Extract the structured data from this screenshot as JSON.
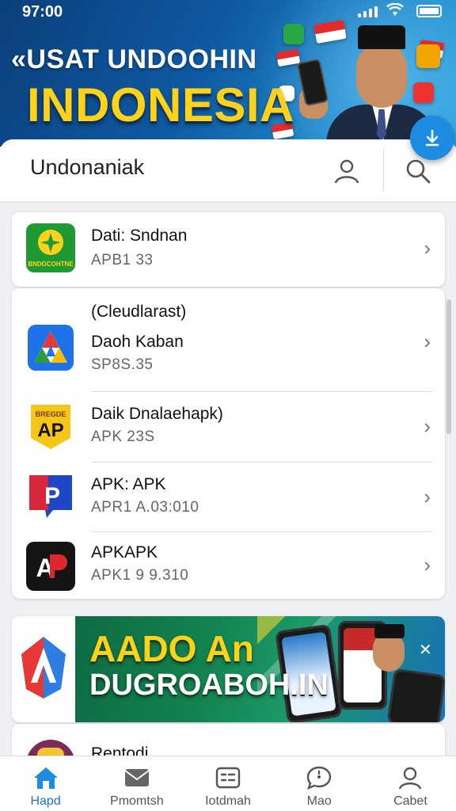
{
  "status_bar": {
    "time": "97:00"
  },
  "hero": {
    "line1": "«USAT UNDOOHIN",
    "line2": "INDONESIA"
  },
  "header": {
    "title": "Undonaniak"
  },
  "apps_top": [
    {
      "name": "Dati: Sndnan",
      "version": "APB1 33",
      "icon_text": "BNDOCOHTNE",
      "icon_color": "#1f9a33"
    }
  ],
  "apps_list": [
    {
      "section": "(Cleudlarast)",
      "name": "Daoh Kaban",
      "version": "SP8S.35",
      "icon": "play-store-like-icon"
    },
    {
      "name": "Daik Dnalaehapk)",
      "version": "APK 23S",
      "icon_text": "BREGDE",
      "icon_color": "#f5c518"
    },
    {
      "name": "APK: APK",
      "version": "APR1 A.03:010",
      "icon": "apk-p-icon"
    },
    {
      "name": "APKAPK",
      "version": "APK1 9 9.310",
      "icon": "ap-dark-icon"
    }
  ],
  "promo": {
    "line1": "AADO An",
    "line2": "DUGROABOH.IN"
  },
  "partial_item": {
    "name": "Rentodi"
  },
  "bottom_nav": [
    {
      "label": "Hapd",
      "icon": "home-icon",
      "active": true
    },
    {
      "label": "Pmomtsh",
      "icon": "mail-icon",
      "active": false
    },
    {
      "label": "Iotdmah",
      "icon": "list-icon",
      "active": false
    },
    {
      "label": "Mao",
      "icon": "chat-icon",
      "active": false
    },
    {
      "label": "Cabet",
      "icon": "profile-icon",
      "active": false
    }
  ],
  "colors": {
    "hero_bg": "#0f5aa3",
    "hero_yellow": "#ffd21a",
    "accent": "#1d8be0",
    "active_nav": "#1d73c9"
  }
}
